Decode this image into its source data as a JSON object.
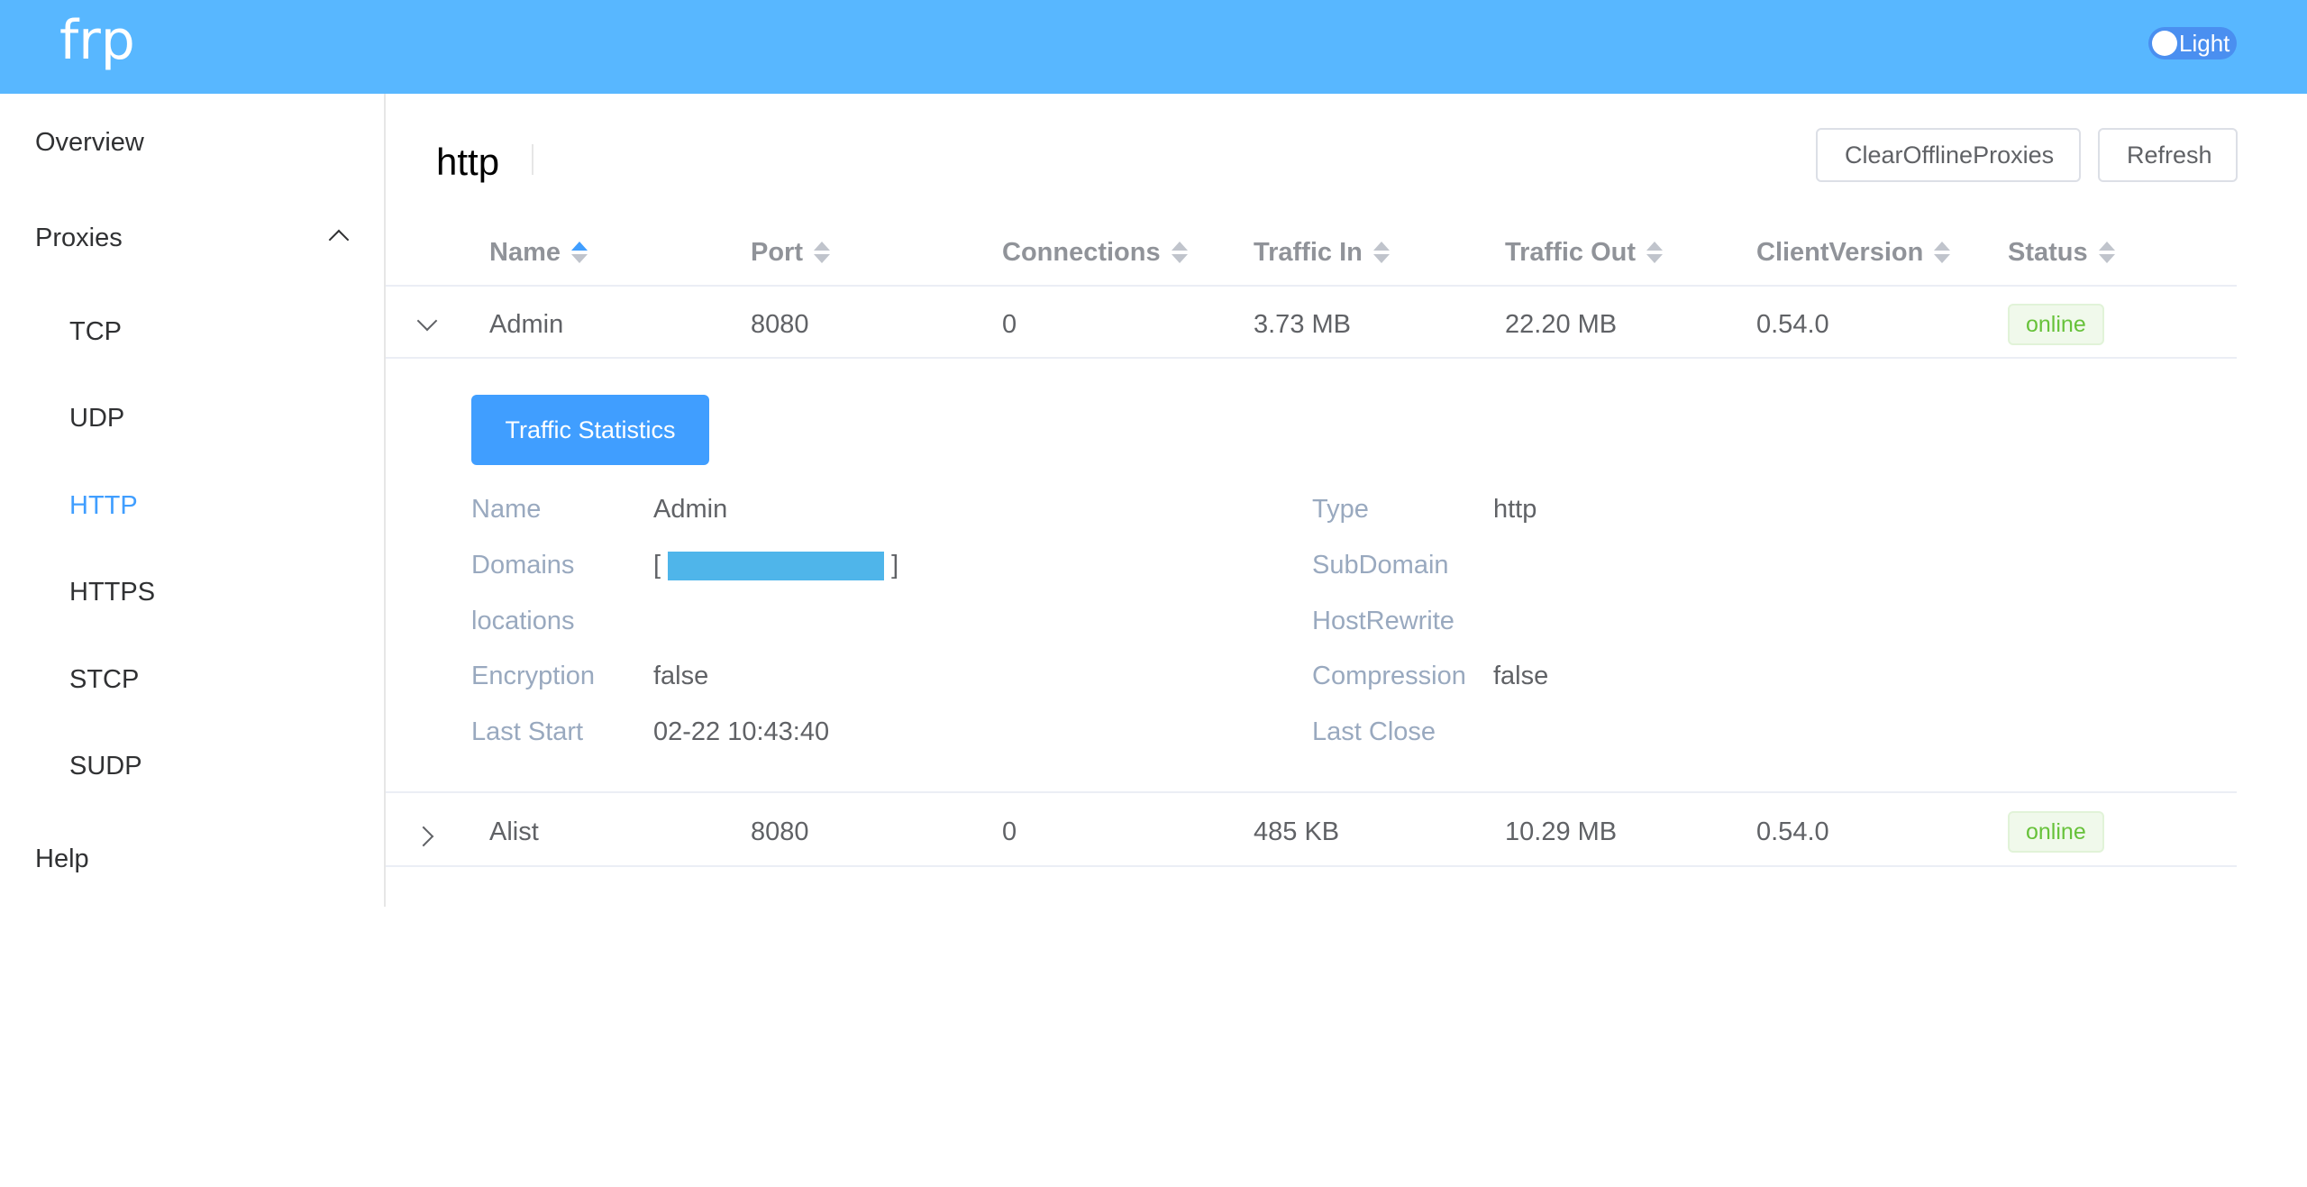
{
  "header": {
    "brand": "frp",
    "theme_label": "Light"
  },
  "sidebar": {
    "items": [
      {
        "label": "Overview"
      },
      {
        "label": "Proxies"
      },
      {
        "label": "TCP"
      },
      {
        "label": "UDP"
      },
      {
        "label": "HTTP"
      },
      {
        "label": "HTTPS"
      },
      {
        "label": "STCP"
      },
      {
        "label": "SUDP"
      },
      {
        "label": "Help"
      }
    ],
    "active": "HTTP"
  },
  "main": {
    "title": "http",
    "clear_button": "ClearOfflineProxies",
    "refresh_button": "Refresh",
    "columns": [
      "Name",
      "Port",
      "Connections",
      "Traffic In",
      "Traffic Out",
      "ClientVersion",
      "Status"
    ],
    "rows": [
      {
        "name": "Admin",
        "port": "8080",
        "connections": "0",
        "traffic_in": "3.73 MB",
        "traffic_out": "22.20 MB",
        "client_version": "0.54.0",
        "status": "online"
      },
      {
        "name": "Alist",
        "port": "8080",
        "connections": "0",
        "traffic_in": "485 KB",
        "traffic_out": "10.29 MB",
        "client_version": "0.54.0",
        "status": "online"
      }
    ],
    "details": {
      "traffic_button": "Traffic Statistics",
      "labels": {
        "name": "Name",
        "type": "Type",
        "domains": "Domains",
        "subdomain": "SubDomain",
        "locations": "locations",
        "hostrewrite": "HostRewrite",
        "encryption": "Encryption",
        "compression": "Compression",
        "last_start": "Last Start",
        "last_close": "Last Close"
      },
      "values": {
        "name": "Admin",
        "type": "http",
        "domains_open": "[",
        "domains_close": "]",
        "encryption": "false",
        "compression": "false",
        "last_start": "02-22 10:43:40"
      }
    }
  },
  "colors": {
    "header": "#58b7ff",
    "accent": "#409eff",
    "online": "#67c23a"
  }
}
